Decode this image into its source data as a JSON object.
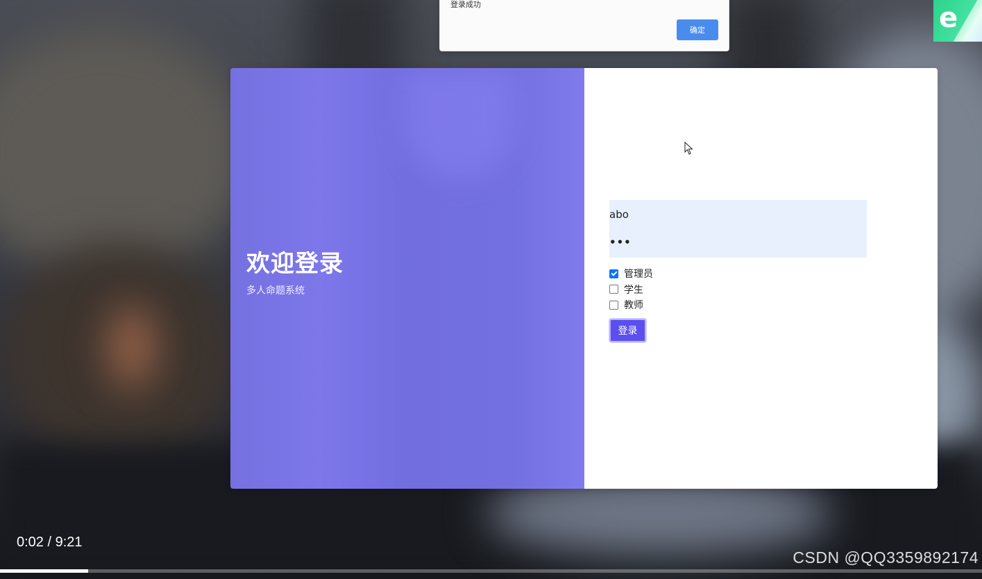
{
  "alert": {
    "message": "登录成功",
    "ok_label": "确定"
  },
  "card": {
    "title": "欢迎登录",
    "subtitle": "多人命题系统"
  },
  "form": {
    "username_value": "abo",
    "password_value": "•••",
    "roles": [
      {
        "label": "管理员",
        "checked": true
      },
      {
        "label": "学生",
        "checked": false
      },
      {
        "label": "教师",
        "checked": false
      }
    ],
    "login_label": "登录"
  },
  "player": {
    "time": "0:02 / 9:21",
    "progress": 0.0036
  },
  "watermark": "CSDN @QQ3359892174",
  "corner_badge": {
    "icon": "browser-e-icon",
    "glyph": "e"
  },
  "colors": {
    "accent": "#5b4ff0",
    "panel": "#7370e1",
    "alert_button": "#4a8cee"
  }
}
